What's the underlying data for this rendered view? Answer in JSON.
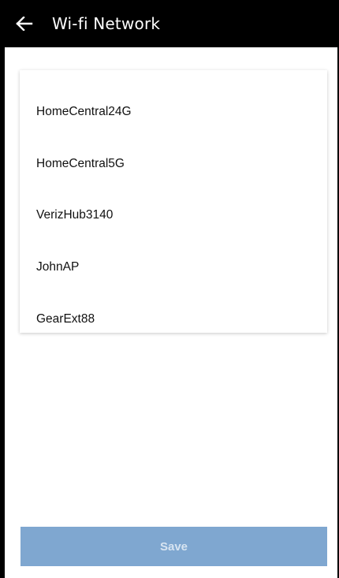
{
  "app_bar": {
    "title": "Wi-fi Network",
    "back_icon": "arrow-left-icon"
  },
  "networks": [
    "HomeCentral24G",
    "HomeCentral5G",
    "VerizHub3140",
    "JohnAP",
    "GearExt88"
  ],
  "save_button": {
    "label": "Save",
    "state": "disabled"
  },
  "colors": {
    "app_bar_bg": "#000000",
    "save_button_bg": "#7fa7d0",
    "save_button_text": "#d7e4f1"
  }
}
